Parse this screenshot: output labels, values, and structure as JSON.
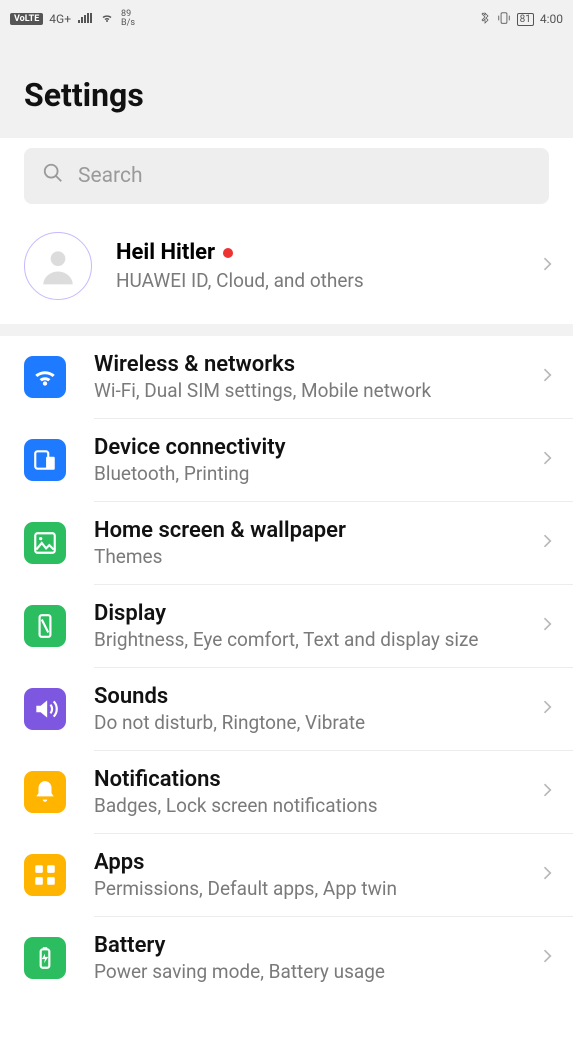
{
  "status": {
    "volte": "VoLTE",
    "signal": "4G+",
    "speed_top": "89",
    "speed_unit": "B/s",
    "battery": "81",
    "time": "4:00"
  },
  "header": {
    "title": "Settings"
  },
  "search": {
    "placeholder": "Search"
  },
  "account": {
    "name": "Heil Hitler",
    "sub": "HUAWEI ID, Cloud, and others"
  },
  "rows": [
    {
      "icon": "wifi",
      "color": "c-blue",
      "title": "Wireless & networks",
      "sub": "Wi-Fi, Dual SIM settings, Mobile network"
    },
    {
      "icon": "devices",
      "color": "c-blue",
      "title": "Device connectivity",
      "sub": "Bluetooth, Printing"
    },
    {
      "icon": "image",
      "color": "c-green",
      "title": "Home screen & wallpaper",
      "sub": "Themes"
    },
    {
      "icon": "phone",
      "color": "c-green",
      "title": "Display",
      "sub": "Brightness, Eye comfort, Text and display size"
    },
    {
      "icon": "sound",
      "color": "c-purple",
      "title": "Sounds",
      "sub": "Do not disturb, Ringtone, Vibrate"
    },
    {
      "icon": "bell",
      "color": "c-yellow",
      "title": "Notifications",
      "sub": "Badges, Lock screen notifications"
    },
    {
      "icon": "apps",
      "color": "c-yellow",
      "title": "Apps",
      "sub": "Permissions, Default apps, App twin"
    },
    {
      "icon": "battery",
      "color": "c-green",
      "title": "Battery",
      "sub": "Power saving mode, Battery usage"
    }
  ]
}
